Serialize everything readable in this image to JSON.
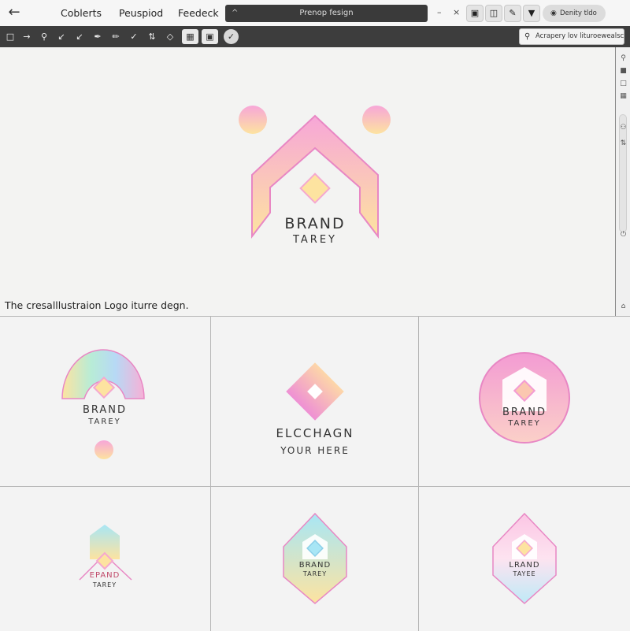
{
  "topbar": {
    "menu": [
      "Coblerts",
      "Peuspiod",
      "Feedeck"
    ],
    "project_title": "Prenop fesign",
    "window_controls": [
      "–",
      "×"
    ],
    "user_label": "Denity tldo"
  },
  "toolbar": {
    "search_placeholder": "Acrapery lov lituroewealsc."
  },
  "main_logo": {
    "name": "BRAND",
    "tagline": "TAREY"
  },
  "caption": "The cresalllustraion Logo iturre degn.",
  "variants": [
    {
      "name": "BRAND",
      "tagline": "TAREY"
    },
    {
      "name": "ELCCHAGN",
      "tagline": "YOUR HERE"
    },
    {
      "name": "BRAND",
      "tagline": "TAREY"
    },
    {
      "name": "EPAND",
      "tagline": "TAREY"
    },
    {
      "name": "BRAND",
      "tagline": "TAREY"
    },
    {
      "name": "LRAND",
      "tagline": "TAYEE"
    }
  ],
  "colors": {
    "pink": "#f4a8d6",
    "peach": "#fde3a0",
    "cyan": "#a8e6f5",
    "outline": "#e887c4"
  }
}
